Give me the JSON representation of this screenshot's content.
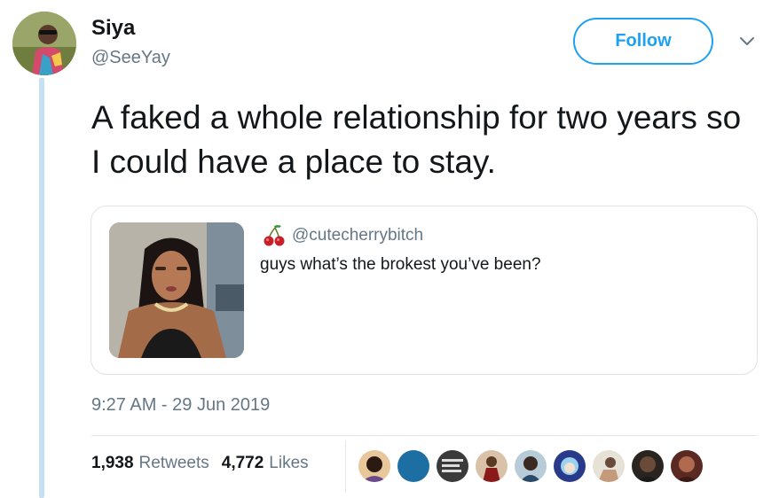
{
  "author": {
    "name": "Siya",
    "handle": "@SeeYay",
    "avatar_icon": "profile-photo"
  },
  "follow_label": "Follow",
  "tweet_text": "A faked a whole relationship for two years so I could have a place to stay.",
  "quoted_tweet": {
    "emoji_icon": "cherry-emoji",
    "handle": "@cutecherrybitch",
    "text": "guys what’s the brokest you’ve been?",
    "image_icon": "quoted-photo"
  },
  "timestamp": "9:27 AM - 29 Jun 2019",
  "stats": {
    "retweets_count": "1,938",
    "retweets_label": "Retweets",
    "likes_count": "4,772",
    "likes_label": "Likes"
  },
  "colors": {
    "accent": "#1da1f2",
    "secondary_text": "#657786",
    "thread_line": "#c7dff2"
  }
}
